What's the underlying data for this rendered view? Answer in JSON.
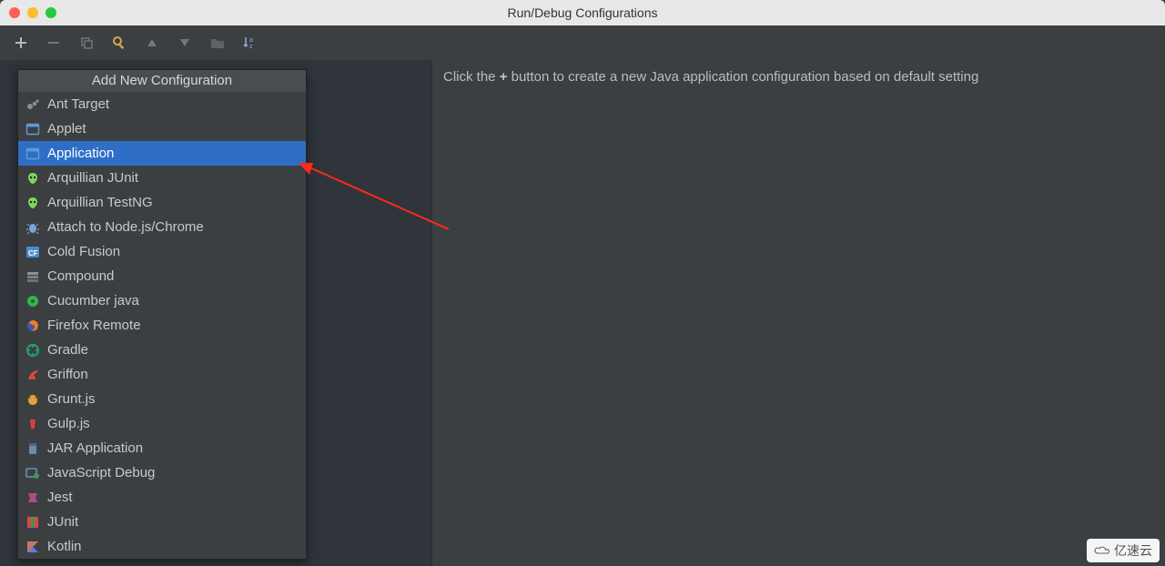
{
  "window": {
    "title": "Run/Debug Configurations"
  },
  "popup": {
    "header": "Add New Configuration",
    "items": [
      {
        "label": "Ant Target",
        "icon": "ant-icon",
        "iconColor": "#8a8f94",
        "selected": false
      },
      {
        "label": "Applet",
        "icon": "window-icon",
        "iconColor": "#5d9bd4",
        "selected": false
      },
      {
        "label": "Application",
        "icon": "window-icon",
        "iconColor": "#5d9bd4",
        "selected": true
      },
      {
        "label": "Arquillian JUnit",
        "icon": "alien-icon",
        "iconColor": "#7fd65a",
        "selected": false
      },
      {
        "label": "Arquillian TestNG",
        "icon": "alien-icon",
        "iconColor": "#7fd65a",
        "selected": false
      },
      {
        "label": "Attach to Node.js/Chrome",
        "icon": "bug-icon",
        "iconColor": "#7aa3d6",
        "selected": false
      },
      {
        "label": "Cold Fusion",
        "icon": "cf-icon",
        "iconColor": "#4b8acb",
        "selected": false
      },
      {
        "label": "Compound",
        "icon": "stack-icon",
        "iconColor": "#8a9099",
        "selected": false
      },
      {
        "label": "Cucumber java",
        "icon": "cucumber-icon",
        "iconColor": "#37b24d",
        "selected": false
      },
      {
        "label": "Firefox Remote",
        "icon": "firefox-icon",
        "iconColor": "#ff7b1a",
        "selected": false
      },
      {
        "label": "Gradle",
        "icon": "gradle-icon",
        "iconColor": "#23a067",
        "selected": false
      },
      {
        "label": "Griffon",
        "icon": "griffon-icon",
        "iconColor": "#d94a3a",
        "selected": false
      },
      {
        "label": "Grunt.js",
        "icon": "grunt-icon",
        "iconColor": "#e0a33a",
        "selected": false
      },
      {
        "label": "Gulp.js",
        "icon": "gulp-icon",
        "iconColor": "#d44141",
        "selected": false
      },
      {
        "label": "JAR Application",
        "icon": "jar-icon",
        "iconColor": "#6e8aa6",
        "selected": false
      },
      {
        "label": "JavaScript Debug",
        "icon": "jsdebug-icon",
        "iconColor": "#6aa2de",
        "selected": false
      },
      {
        "label": "Jest",
        "icon": "jest-icon",
        "iconColor": "#ae4a8a",
        "selected": false
      },
      {
        "label": "JUnit",
        "icon": "junit-icon",
        "iconColor": "#d64848",
        "selected": false
      },
      {
        "label": "Kotlin",
        "icon": "kotlin-icon",
        "iconColor": "#6d74e0",
        "selected": false
      }
    ]
  },
  "hint": {
    "prefix": "Click the ",
    "plus": "+",
    "suffix": " button to create a new Java application configuration based on default setting"
  },
  "watermark": {
    "text": "亿速云"
  }
}
